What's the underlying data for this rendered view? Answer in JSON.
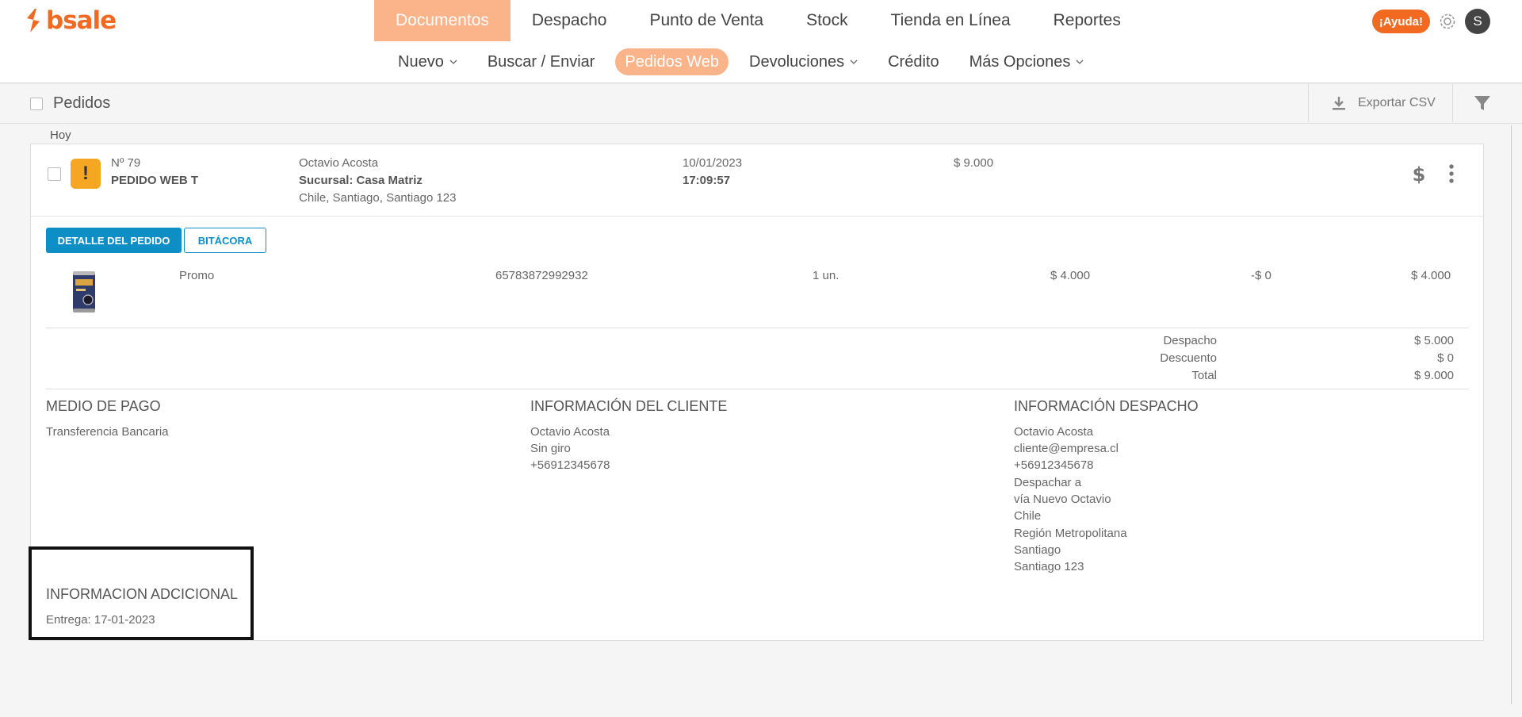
{
  "brand": {
    "name": "bsale",
    "color": "#f26a21"
  },
  "main_nav": [
    {
      "label": "Documentos",
      "active": true
    },
    {
      "label": "Despacho",
      "active": false
    },
    {
      "label": "Punto de Venta",
      "active": false
    },
    {
      "label": "Stock",
      "active": false
    },
    {
      "label": "Tienda en Línea",
      "active": false
    },
    {
      "label": "Reportes",
      "active": false
    }
  ],
  "header": {
    "help_label": "¡Ayuda!",
    "avatar_initial": "S"
  },
  "sub_nav": [
    {
      "label": "Nuevo",
      "dropdown": true,
      "active": false
    },
    {
      "label": "Buscar / Enviar",
      "dropdown": false,
      "active": false
    },
    {
      "label": "Pedidos Web",
      "dropdown": false,
      "active": true
    },
    {
      "label": "Devoluciones",
      "dropdown": true,
      "active": false
    },
    {
      "label": "Crédito",
      "dropdown": false,
      "active": false
    },
    {
      "label": "Más Opciones",
      "dropdown": true,
      "active": false
    }
  ],
  "toolbar": {
    "title": "Pedidos",
    "export_label": "Exportar CSV"
  },
  "list": {
    "date_group": "Hoy"
  },
  "order": {
    "number": "Nº 79",
    "type": "PEDIDO WEB T",
    "status_icon": "warning-icon",
    "customer_name": "Octavio Acosta",
    "branch": "Sucursal: Casa Matriz",
    "address": "Chile, Santiago, Santiago 123",
    "date": "10/01/2023",
    "time": "17:09:57",
    "amount": "$ 9.000"
  },
  "tabs": {
    "detail": "DETALLE DEL PEDIDO",
    "log": "BITÁCORA"
  },
  "line_item": {
    "name": "Promo",
    "code": "65783872992932",
    "quantity": "1 un.",
    "price": "$ 4.000",
    "discount": "-$ 0",
    "total": "$ 4.000"
  },
  "totals": {
    "shipping_label": "Despacho",
    "shipping_value": "$ 5.000",
    "discount_label": "Descuento",
    "discount_value": "$ 0",
    "total_label": "Total",
    "total_value": "$ 9.000"
  },
  "payment": {
    "title": "MEDIO DE PAGO",
    "method": "Transferencia Bancaria"
  },
  "client_info": {
    "title": "INFORMACIÓN DEL CLIENTE",
    "lines": [
      "Octavio Acosta",
      "Sin giro",
      "+56912345678"
    ]
  },
  "shipping_info": {
    "title": "INFORMACIÓN DESPACHO",
    "lines": [
      "Octavio Acosta",
      "cliente@empresa.cl",
      "+56912345678",
      "Despachar a",
      "vía Nuevo Octavio",
      "Chile",
      "Región Metropolitana",
      "Santiago",
      "Santiago 123"
    ]
  },
  "additional_info": {
    "title": "INFORMACION ADCICIONAL",
    "delivery": "Entrega: 17-01-2023"
  },
  "colors": {
    "accent": "#fbb38a",
    "primary_blue": "#0d8fc6",
    "warning": "#f5a623"
  }
}
